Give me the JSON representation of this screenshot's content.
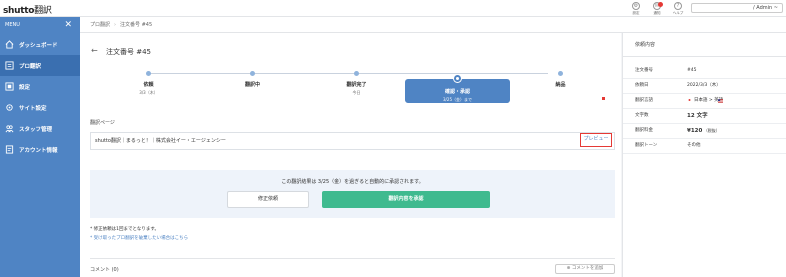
{
  "header": {
    "logo_prefix": "shutto",
    "logo_suffix": "翻訳",
    "icons": [
      {
        "name": "settings-icon",
        "label": "設定"
      },
      {
        "name": "notification-icon",
        "label": "通知"
      },
      {
        "name": "help-icon",
        "label": "ヘルプ"
      }
    ],
    "account": "/ Admin ~"
  },
  "sidebar": {
    "menu_label": "MENU",
    "items": [
      {
        "label": "ダッシュボード",
        "icon": "home-icon"
      },
      {
        "label": "プロ翻訳",
        "icon": "document-icon",
        "active": true
      },
      {
        "label": "設定",
        "icon": "translate-icon"
      },
      {
        "label": "サイト設定",
        "icon": "gear-icon"
      },
      {
        "label": "スタッフ管理",
        "icon": "users-icon"
      },
      {
        "label": "アカウント情報",
        "icon": "account-icon"
      }
    ]
  },
  "breadcrumb": {
    "root": "プロ翻訳",
    "current": "注文番号 #45"
  },
  "main": {
    "order_title": "注文番号 #45",
    "steps": [
      {
        "name": "依頼",
        "date": "3/3（木）"
      },
      {
        "name": "翻訳中",
        "date": ""
      },
      {
        "name": "翻訳完了",
        "date": "今日"
      },
      {
        "name": "確認・承認",
        "date": "3/25（金）まで",
        "current": true
      },
      {
        "name": "納品",
        "date": ""
      }
    ],
    "page_section_label": "翻訳ページ",
    "page_title": "shutto翻訳｜まるっと！｜株式会社イー・エージェンシー",
    "preview_label": "プレビュー",
    "confirm_message": "この翻訳結果は 3/25（金）を過ぎると自動的に承認されます。",
    "fix_request_label": "修正依頼",
    "approve_label": "翻訳内容を承認",
    "note_1": "* 修正依頼は1回までとなります。",
    "note_2": "* 受け取ったプロ翻訳を破棄したい場合はこちら",
    "comments_title": "コメント (0)",
    "add_comment_label": "コメントを追加"
  },
  "details": {
    "title": "依頼内容",
    "rows": [
      {
        "key": "注文番号",
        "value": "#45"
      },
      {
        "key": "依頼日",
        "value": "2022/3/3（木）"
      },
      {
        "key": "翻訳言語",
        "value": "日本語 > 英語",
        "flags": true
      },
      {
        "key": "文字数",
        "value": "12 文字",
        "big": true
      },
      {
        "key": "翻訳料金",
        "value": "¥120",
        "suffix": "（税抜）",
        "big": true
      },
      {
        "key": "翻訳トーン",
        "value": "その他"
      }
    ]
  },
  "colors": {
    "sidebar": "#4f84c4",
    "sidebar_active": "#3a6fb0",
    "approve": "#3fba8f",
    "highlight": "#e53935"
  }
}
